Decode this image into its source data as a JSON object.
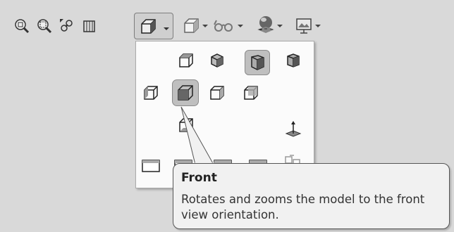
{
  "toolbar": {
    "icons": [
      "zoom-to-fit-icon",
      "zoom-to-area-icon",
      "previous-view-icon",
      "section-view-icon",
      "view-orientation-icon",
      "display-style-icon",
      "hide-show-items-icon",
      "edit-appearance-icon",
      "apply-scene-icon"
    ]
  },
  "flyout": {
    "items": [
      "top-view-icon",
      "isometric-view-icon",
      "trimetric-view-icon",
      "dimetric-view-icon",
      "left-view-icon",
      "front-view-icon",
      "right-view-icon",
      "back-view-icon",
      "bottom-view-icon",
      "normal-to-icon",
      "single-view-icon",
      "two-view-horizontal-icon",
      "two-view-vertical-icon",
      "four-view-icon",
      "link-views-icon"
    ],
    "selected": "front-view-icon"
  },
  "tooltip": {
    "title": "Front",
    "body": "Rotates and zooms the model to the front view orientation."
  }
}
